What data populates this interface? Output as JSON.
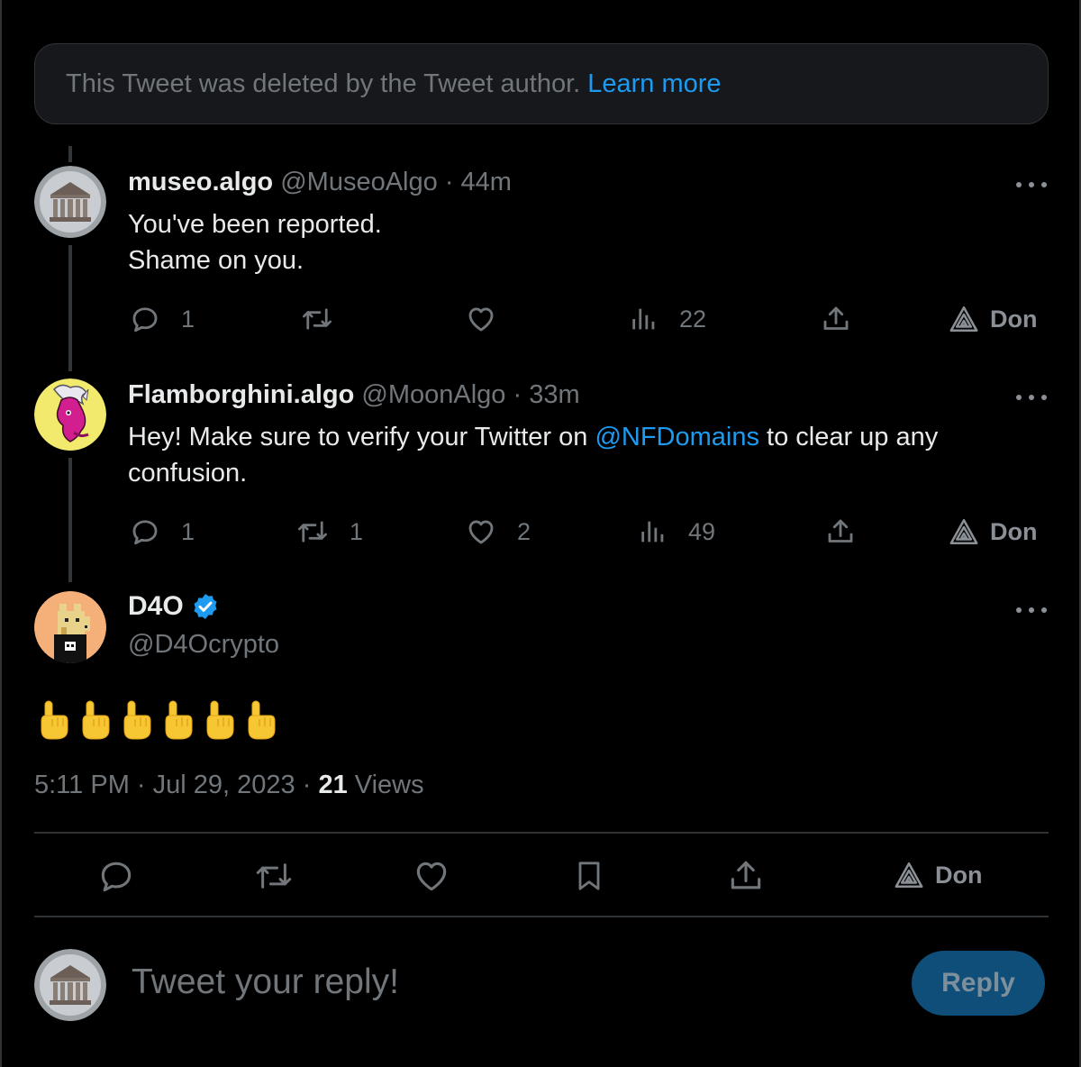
{
  "deleted_notice": {
    "text": "This Tweet was deleted by the Tweet author.",
    "link": "Learn more"
  },
  "replies": [
    {
      "name": "museo.algo",
      "handle": "@MuseoAlgo",
      "separator": "·",
      "time": "44m",
      "lines": [
        "You've been reported.",
        "Shame on you."
      ],
      "actions": {
        "replies": "1",
        "retweets": "",
        "likes": "",
        "views": "22",
        "don": "Don"
      }
    },
    {
      "name": "Flamborghini.algo",
      "handle": "@MoonAlgo",
      "separator": "·",
      "time": "33m",
      "text_before": "Hey! Make sure to verify your Twitter on ",
      "mention": "@NFDomains",
      "text_after": " to clear up any",
      "line2": "confusion.",
      "actions": {
        "replies": "1",
        "retweets": "1",
        "likes": "2",
        "views": "49",
        "don": "Don"
      }
    }
  ],
  "main_tweet": {
    "name": "D4O",
    "handle": "@D4Ocrypto",
    "emoji_count": 6,
    "time": "5:11 PM",
    "date": "Jul 29, 2023",
    "separator": "·",
    "views_count": "21",
    "views_label": "Views",
    "don": "Don"
  },
  "composer": {
    "placeholder": "Tweet your reply!",
    "button": "Reply"
  },
  "colors": {
    "background": "#000000",
    "accent": "#1d9bf0",
    "muted": "#71767b",
    "verified": "#1d9bf0",
    "reply_button": "#0f4e78"
  },
  "icons": [
    "reply-icon",
    "retweet-icon",
    "like-icon",
    "views-icon",
    "share-icon",
    "don-icon",
    "bookmark-icon",
    "verified-icon",
    "more-icon",
    "pointing-up-emoji"
  ]
}
